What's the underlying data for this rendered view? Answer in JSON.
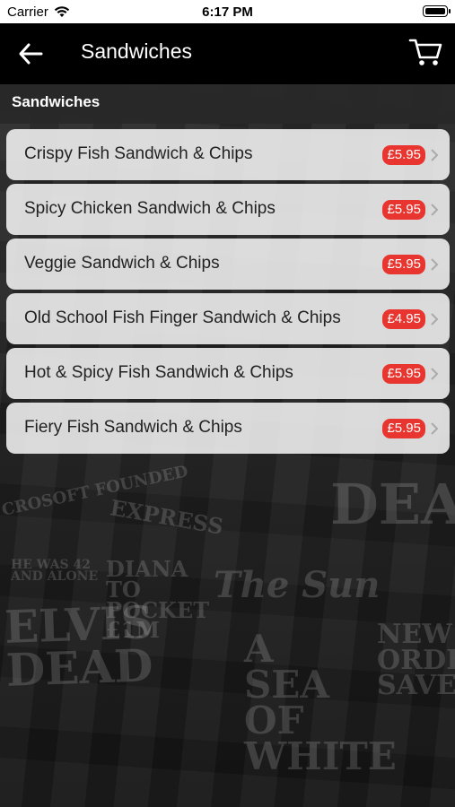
{
  "status": {
    "carrier": "Carrier",
    "time": "6:17 PM"
  },
  "navbar": {
    "title": "Sandwiches"
  },
  "section": {
    "title": "Sandwiches"
  },
  "items": [
    {
      "name": "Crispy Fish Sandwich & Chips",
      "price": "£5.95"
    },
    {
      "name": "Spicy Chicken Sandwich & Chips",
      "price": "£5.95"
    },
    {
      "name": "Veggie Sandwich & Chips",
      "price": "£5.95"
    },
    {
      "name": "Old School Fish Finger Sandwich & Chips",
      "price": "£4.95"
    },
    {
      "name": "Hot & Spicy Fish Sandwich & Chips",
      "price": "£5.95"
    },
    {
      "name": "Fiery Fish Sandwich & Chips",
      "price": "£5.95"
    }
  ],
  "background_newspaper": {
    "headlines": [
      "ELVIS DEAD",
      "A SEA OF WHITE",
      "DEA",
      "NEW ORDE SAVE",
      "DIANA TO POCKET £1M",
      "The Sun",
      "CROSOFT FOUNDED",
      "EXPRESS",
      "HE WAS 42 AND ALONE"
    ]
  },
  "colors": {
    "price_badge": "#e8352f",
    "navbar": "#000000",
    "row": "#f8f8f8"
  }
}
